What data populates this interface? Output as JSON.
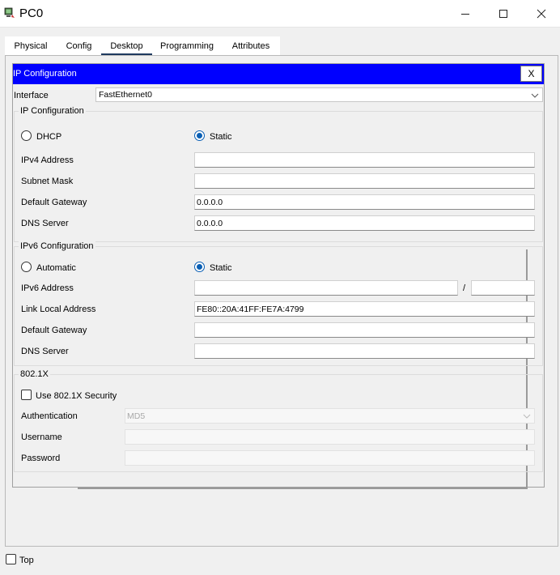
{
  "window": {
    "title": "PC0",
    "icon": "pc-icon",
    "controls": [
      "minimize-icon",
      "maximize-icon",
      "close-icon"
    ]
  },
  "tabs": [
    {
      "label": "Physical",
      "active": false
    },
    {
      "label": "Config",
      "active": false
    },
    {
      "label": "Desktop",
      "active": true
    },
    {
      "label": "Programming",
      "active": false
    },
    {
      "label": "Attributes",
      "active": false
    }
  ],
  "ip_config": {
    "header_title": "IP Configuration",
    "close_label": "X",
    "interface_label": "Interface",
    "interface_value": "FastEthernet0",
    "ipv4_group": {
      "legend": "IP Configuration",
      "dhcp_label": "DHCP",
      "static_label": "Static",
      "selected": "Static",
      "ipv4_label": "IPv4 Address",
      "ipv4_value": "",
      "subnet_label": "Subnet Mask",
      "subnet_value": "",
      "gateway_label": "Default Gateway",
      "gateway_value": "0.0.0.0",
      "dns_label": "DNS Server",
      "dns_value": "0.0.0.0"
    },
    "ipv6_group": {
      "legend": "IPv6 Configuration",
      "auto_label": "Automatic",
      "static_label": "Static",
      "selected": "Static",
      "ipv6_label": "IPv6 Address",
      "ipv6_value": "",
      "slash": "/",
      "prefix_value": "",
      "link_local_label": "Link Local Address",
      "link_local_value": "FE80::20A:41FF:FE7A:4799",
      "gateway_label": "Default Gateway",
      "gateway_value": "",
      "dns_label": "DNS Server",
      "dns_value": ""
    },
    "dot1x_group": {
      "legend": "802.1X",
      "use_label": "Use 802.1X Security",
      "use_checked": false,
      "auth_label": "Authentication",
      "auth_value": "MD5",
      "username_label": "Username",
      "username_value": "",
      "password_label": "Password",
      "password_value": ""
    }
  },
  "footer": {
    "top_label": "Top",
    "top_checked": false
  },
  "colors": {
    "header_bar": "#0000ff",
    "radio_accent": "#0a5fb4",
    "active_tab_underline": "#1f3a5f"
  }
}
